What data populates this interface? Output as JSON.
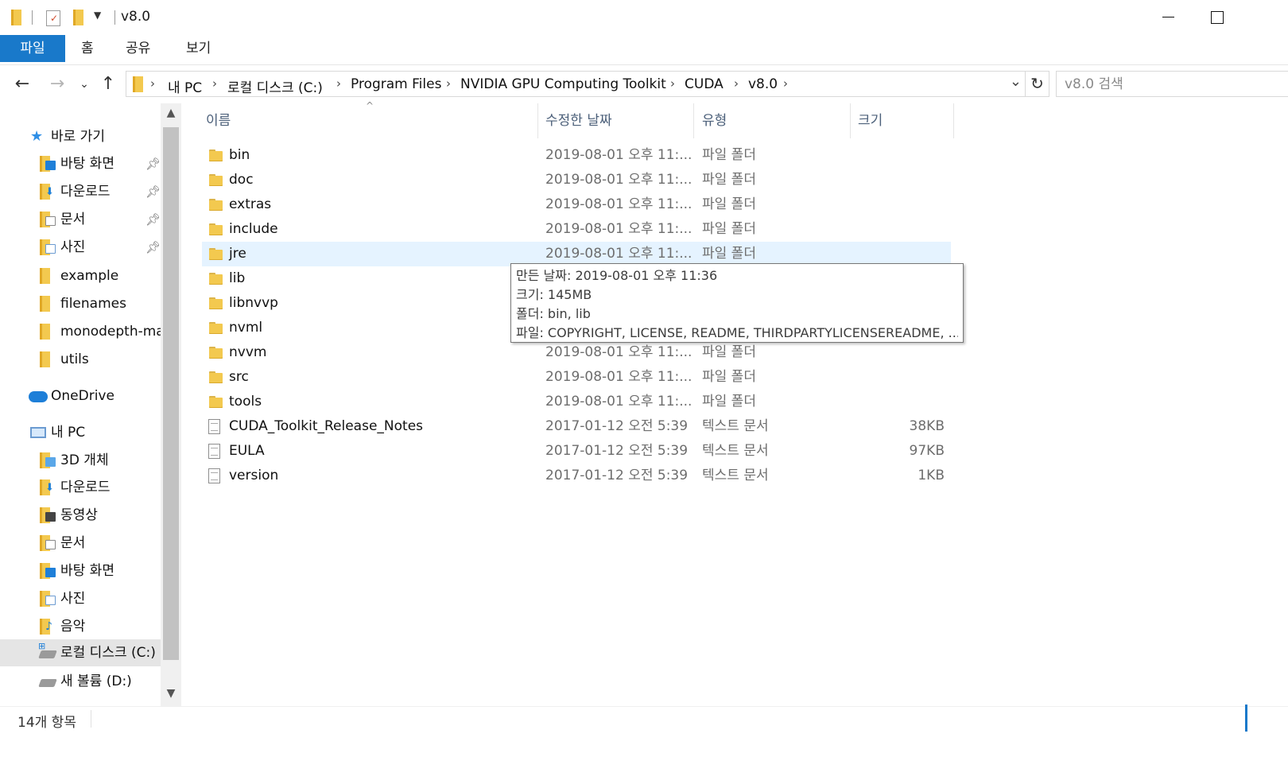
{
  "window": {
    "title": "v8.0"
  },
  "ribbon": {
    "tabs": [
      "파일",
      "홈",
      "공유",
      "보기"
    ]
  },
  "address": {
    "crumbs": [
      "내 PC",
      "로컬 디스크 (C:)",
      "Program Files",
      "NVIDIA GPU Computing Toolkit",
      "CUDA",
      "v8.0"
    ],
    "search_placeholder": "v8.0 검색"
  },
  "sidebar": {
    "quick_access": "바로 가기",
    "pinned": [
      "바탕 화면",
      "다운로드",
      "문서",
      "사진"
    ],
    "recent_folders": [
      "example",
      "filenames",
      "monodepth-master",
      "utils"
    ],
    "onedrive": "OneDrive",
    "this_pc": "내 PC",
    "pc_items": [
      "3D 개체",
      "다운로드",
      "동영상",
      "문서",
      "바탕 화면",
      "사진",
      "음악",
      "로컬 디스크 (C:)",
      "새 볼륨 (D:)"
    ]
  },
  "columns": {
    "name": "이름",
    "date": "수정한 날짜",
    "type": "유형",
    "size": "크기"
  },
  "files": [
    {
      "name": "bin",
      "date": "2019-08-01 오후 11:...",
      "type": "파일 폴더",
      "size": "",
      "kind": "folder"
    },
    {
      "name": "doc",
      "date": "2019-08-01 오후 11:...",
      "type": "파일 폴더",
      "size": "",
      "kind": "folder"
    },
    {
      "name": "extras",
      "date": "2019-08-01 오후 11:...",
      "type": "파일 폴더",
      "size": "",
      "kind": "folder"
    },
    {
      "name": "include",
      "date": "2019-08-01 오후 11:...",
      "type": "파일 폴더",
      "size": "",
      "kind": "folder"
    },
    {
      "name": "jre",
      "date": "2019-08-01 오후 11:...",
      "type": "파일 폴더",
      "size": "",
      "kind": "folder"
    },
    {
      "name": "lib",
      "date": "",
      "type": "",
      "size": "",
      "kind": "folder"
    },
    {
      "name": "libnvvp",
      "date": "",
      "type": "",
      "size": "",
      "kind": "folder"
    },
    {
      "name": "nvml",
      "date": "",
      "type": "",
      "size": "",
      "kind": "folder"
    },
    {
      "name": "nvvm",
      "date": "2019-08-01 오후 11:...",
      "type": "파일 폴더",
      "size": "",
      "kind": "folder"
    },
    {
      "name": "src",
      "date": "2019-08-01 오후 11:...",
      "type": "파일 폴더",
      "size": "",
      "kind": "folder"
    },
    {
      "name": "tools",
      "date": "2019-08-01 오후 11:...",
      "type": "파일 폴더",
      "size": "",
      "kind": "folder"
    },
    {
      "name": "CUDA_Toolkit_Release_Notes",
      "date": "2017-01-12 오전 5:39",
      "type": "텍스트 문서",
      "size": "38KB",
      "kind": "doc"
    },
    {
      "name": "EULA",
      "date": "2017-01-12 오전 5:39",
      "type": "텍스트 문서",
      "size": "97KB",
      "kind": "doc"
    },
    {
      "name": "version",
      "date": "2017-01-12 오전 5:39",
      "type": "텍스트 문서",
      "size": "1KB",
      "kind": "doc"
    }
  ],
  "tooltip": {
    "created": "만든 날짜: 2019-08-01 오후 11:36",
    "size": "크기: 145MB",
    "folders": "폴더: bin, lib",
    "files": "파일: COPYRIGHT, LICENSE, README, THIRDPARTYLICENSEREADME, ..."
  },
  "status": {
    "count": "14개 항목"
  },
  "colors": {
    "accent": "#1979ca",
    "selected": "#cce8ff",
    "hover": "#e5f3ff",
    "folder": "#f3c94f"
  }
}
